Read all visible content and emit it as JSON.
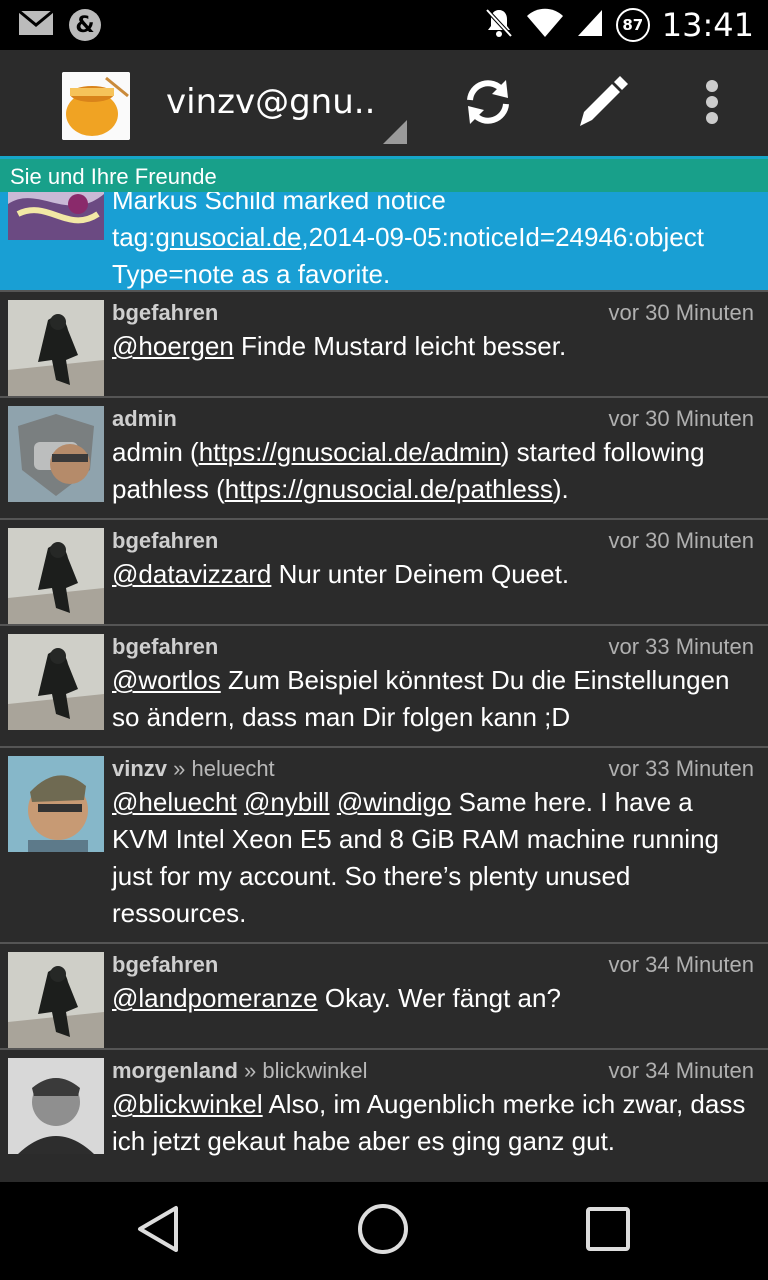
{
  "status": {
    "time": "13:41",
    "battery": "87"
  },
  "actionbar": {
    "account": "vinzv@gnu.."
  },
  "tab": {
    "title": "Sie und Ihre Freunde"
  },
  "highlight": {
    "line1": "Markus Schild marked notice",
    "line2a": "tag:",
    "line2link": "gnusocial.de",
    "line2b": ",2014-09-05:noticeId=24946:object",
    "line3": "Type=note as a favorite."
  },
  "notices": [
    {
      "author": "bgefahren",
      "time": "vor 30 Minuten",
      "mention": "@hoergen",
      "text": " Finde Mustard leicht besser."
    },
    {
      "author": "admin",
      "time": "vor 30 Minuten",
      "t1": "admin (",
      "l1": "https://gnusocial.de/admin",
      "t2": ") started following pathless (",
      "l2": "https://gnusocial.de/pathless",
      "t3": ")."
    },
    {
      "author": "bgefahren",
      "time": "vor 30 Minuten",
      "mention": "@datavizzard",
      "text": " Nur unter Deinem Queet."
    },
    {
      "author": "bgefahren",
      "time": "vor 33 Minuten",
      "mention": "@wortlos",
      "text": " Zum Beispiel könntest Du die Einstellungen so ändern, dass man Dir folgen kann ;D"
    },
    {
      "author": "vinzv",
      "reply": " » heluecht",
      "time": "vor 33 Minuten",
      "m1": "@heluecht",
      "m2": "@nybill",
      "m3": "@windigo",
      "text": " Same here. I have a KVM Intel Xeon E5 and 8 GiB RAM machine running just for my account. So there’s plenty unused ressources."
    },
    {
      "author": "bgefahren",
      "time": "vor 34 Minuten",
      "mention": "@landpomeranze",
      "text": " Okay. Wer fängt an?"
    },
    {
      "author": "morgenland",
      "reply": " » blickwinkel",
      "time": "vor 34 Minuten",
      "mention": "@blickwinkel",
      "text": " Also, im Augenblich merke ich zwar, dass ich jetzt gekaut habe aber es ging ganz gut."
    }
  ]
}
